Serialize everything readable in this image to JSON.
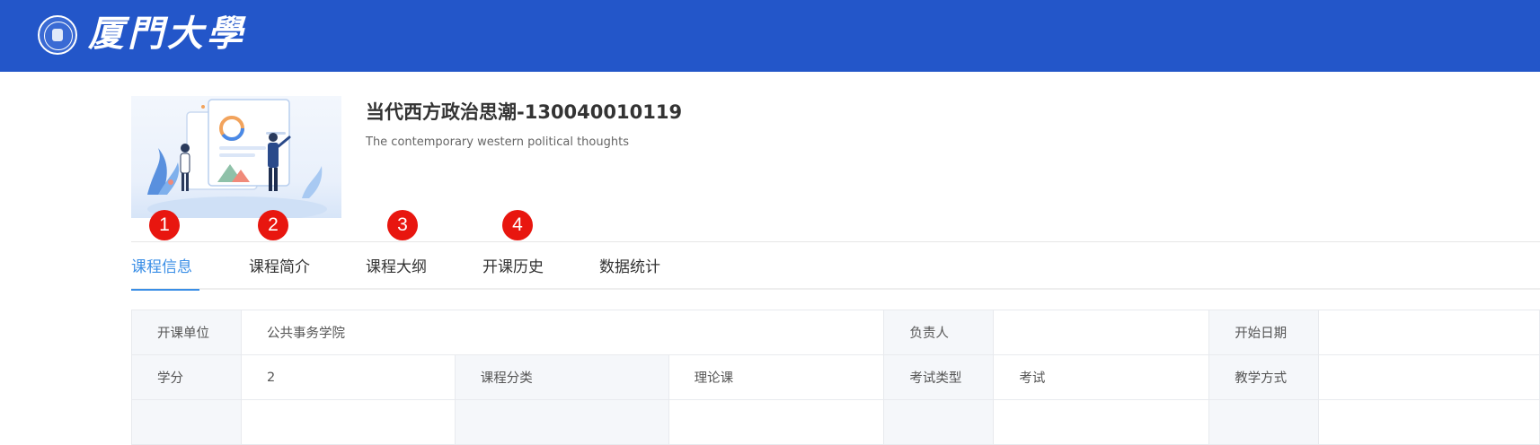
{
  "header": {
    "bg_color": "#2356c9",
    "logo_icon": "xiamen-university-seal-icon",
    "logo_text": "厦門大學"
  },
  "course": {
    "image": "course-illustration",
    "title": "当代西方政治思潮-130040010119",
    "subtitle": "The contemporary western political thoughts"
  },
  "badges": [
    "1",
    "2",
    "3",
    "4"
  ],
  "badge_color": "#e8160f",
  "tabs": [
    {
      "label": "课程信息",
      "active": true
    },
    {
      "label": "课程简介",
      "active": false
    },
    {
      "label": "课程大纲",
      "active": false
    },
    {
      "label": "开课历史",
      "active": false
    },
    {
      "label": "数据统计",
      "active": false
    }
  ],
  "accent_color": "#3a8ee6",
  "info_table": {
    "rows": [
      [
        {
          "type": "label",
          "text": "开课单位"
        },
        {
          "type": "value",
          "text": "公共事务学院"
        },
        {
          "type": "label",
          "text": "负责人"
        },
        {
          "type": "value",
          "text": ""
        },
        {
          "type": "label",
          "text": "开始日期"
        },
        {
          "type": "value",
          "text": ""
        }
      ],
      [
        {
          "type": "label",
          "text": "学分"
        },
        {
          "type": "value",
          "text": "2"
        },
        {
          "type": "label",
          "text": "课程分类"
        },
        {
          "type": "value",
          "text": "理论课"
        },
        {
          "type": "label",
          "text": "考试类型"
        },
        {
          "type": "value",
          "text": "考试"
        },
        {
          "type": "label",
          "text": "教学方式"
        },
        {
          "type": "value",
          "text": ""
        }
      ]
    ]
  }
}
